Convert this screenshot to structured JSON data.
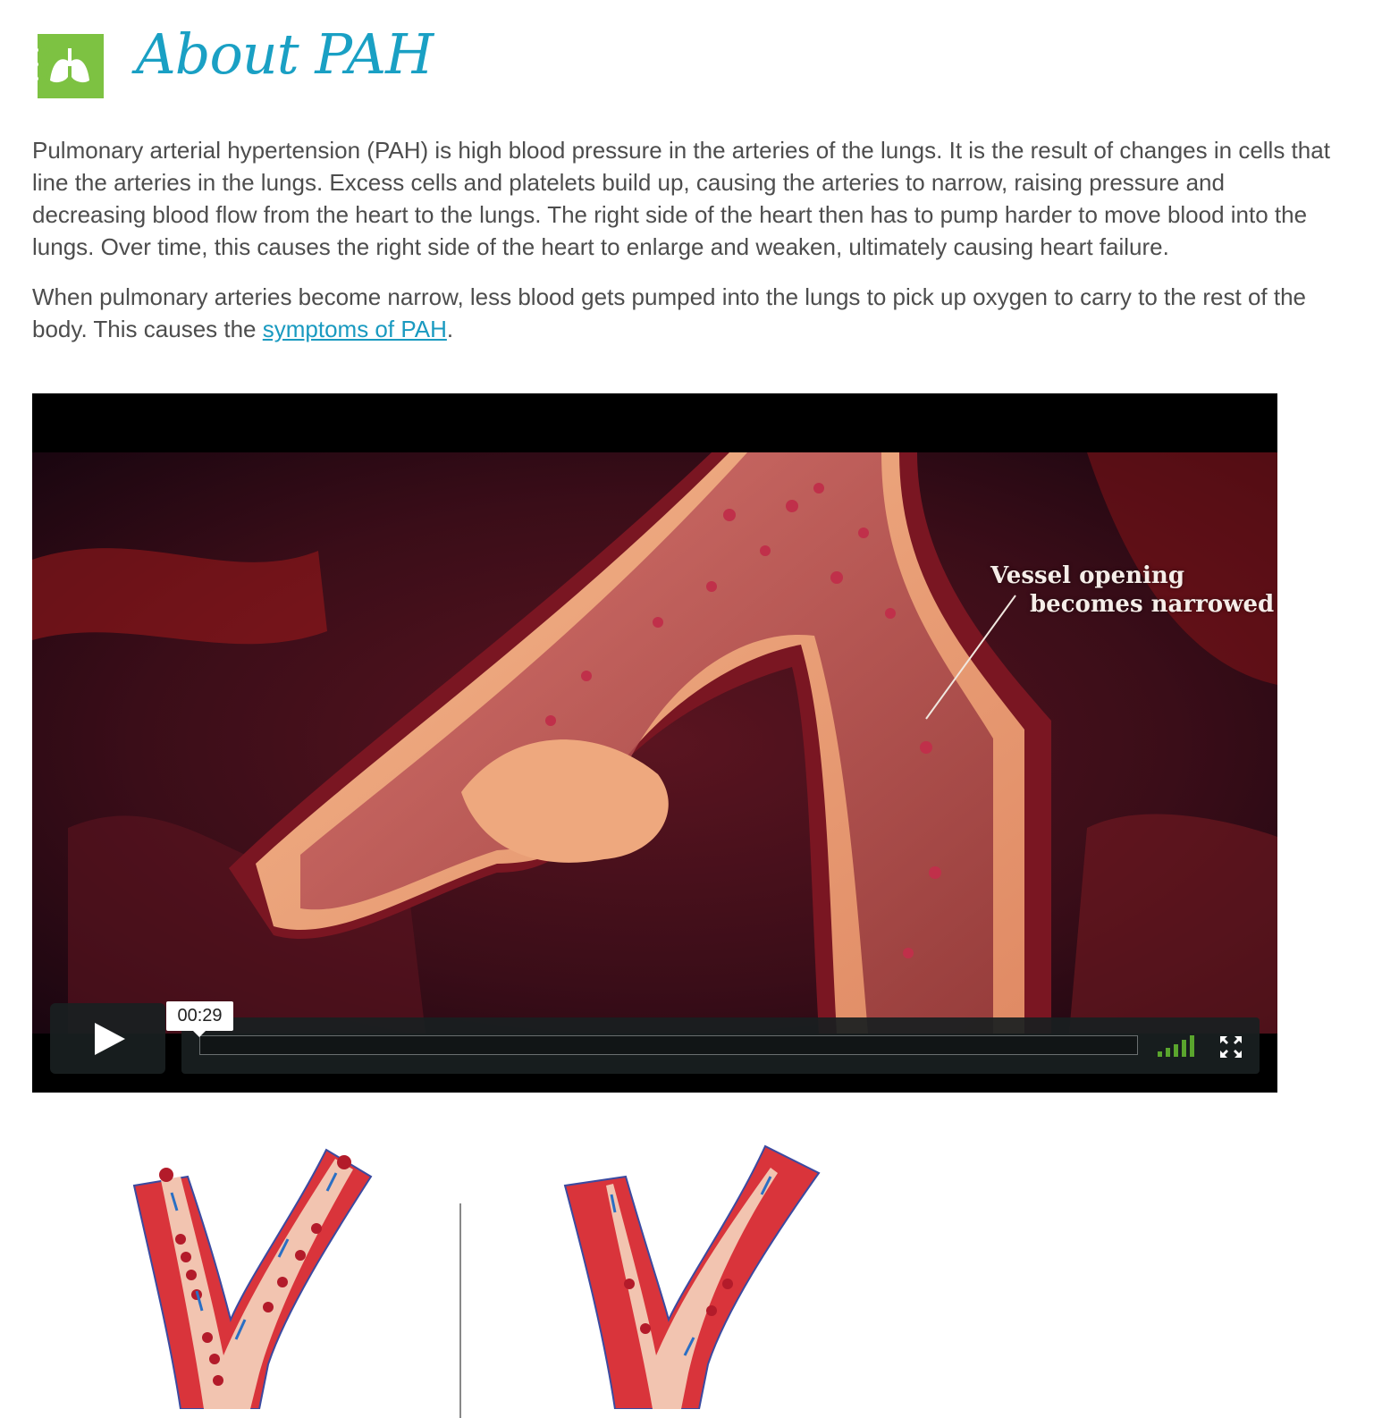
{
  "header": {
    "title": "About PAH",
    "icon": "lungs-notebook-icon",
    "icon_color": "#7dc242",
    "title_color": "#1aa0c4"
  },
  "intro": {
    "paragraph1": "Pulmonary arterial hypertension (PAH) is high blood pressure in the arteries of the lungs. It is the result of changes in cells that line the arteries in the lungs. Excess cells and platelets build up, causing the arteries to narrow, raising pressure and decreasing blood flow from the heart to the lungs. The right side of the heart then has to pump harder to move blood into the lungs. Over time, this causes the right side of the heart to enlarge and weaken, ultimately causing heart failure.",
    "paragraph2_prefix": "When pulmonary arteries become narrow, less blood gets pumped into the lungs to pick up oxygen to carry to the rest of the body. This causes the ",
    "paragraph2_link": "symptoms of PAH",
    "paragraph2_suffix": ".",
    "link_color": "#1a9ac0"
  },
  "video": {
    "caption_line1": "Vessel opening",
    "caption_line2": "becomes narrowed",
    "time_tooltip": "00:29",
    "play_icon": "play-icon",
    "volume_icon": "volume-bars-icon",
    "fullscreen_icon": "fullscreen-icon",
    "accent_color": "#5aa52d"
  },
  "diagrams": {
    "left": "normal-artery-illustration",
    "right": "narrowed-artery-illustration"
  }
}
